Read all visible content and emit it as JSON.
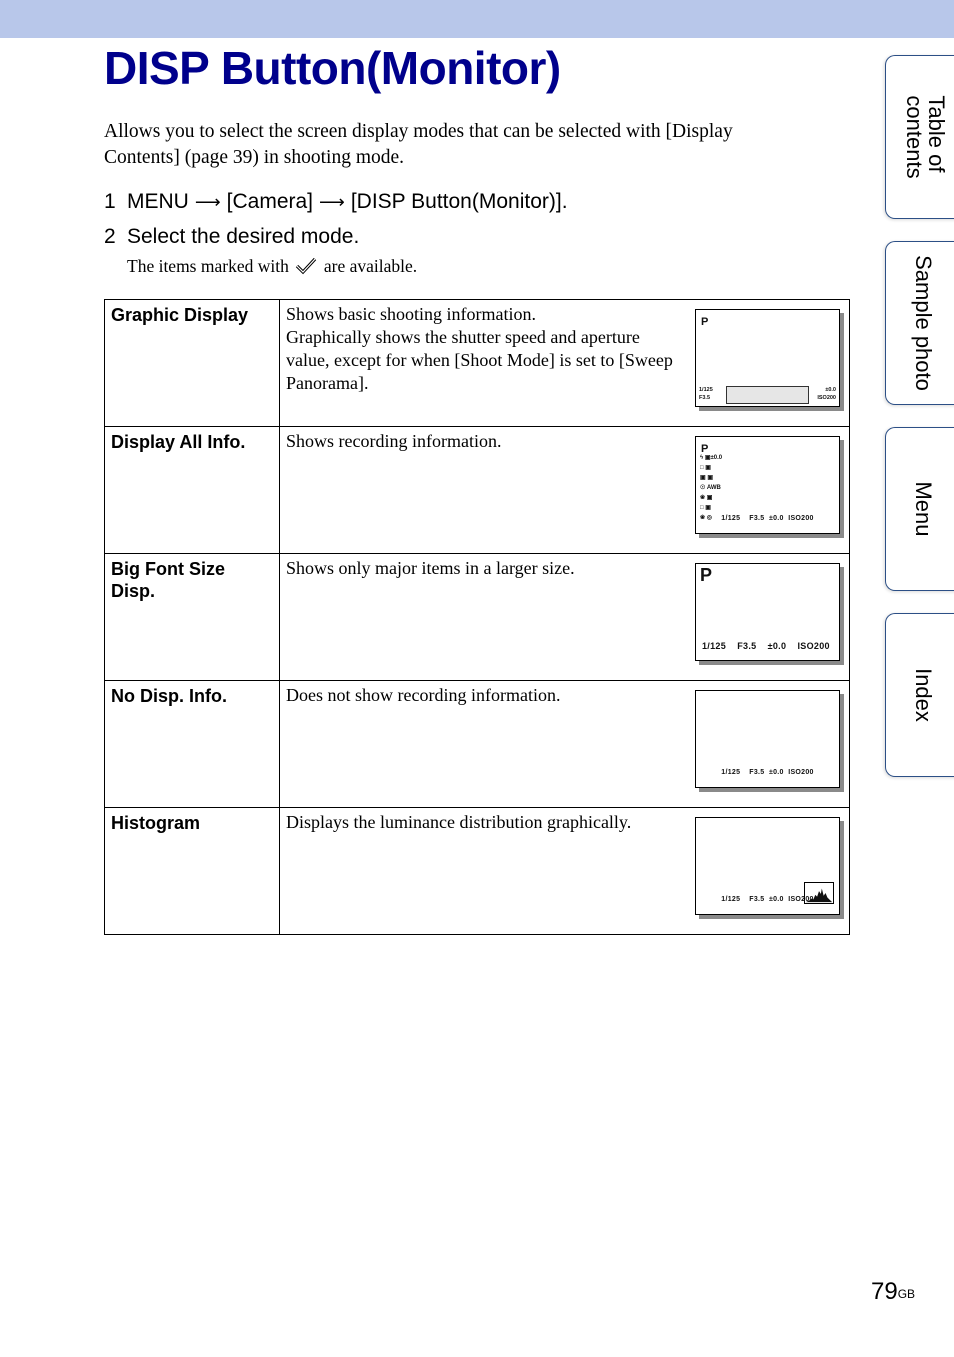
{
  "page": {
    "title": "DISP Button(Monitor)",
    "intro": "Allows you to select the screen display modes that can be selected with [Display Contents] (page 39) in shooting mode.",
    "steps": [
      {
        "number": "1",
        "parts": [
          "MENU",
          "[Camera]",
          "[DISP Button(Monitor)]."
        ],
        "arrow": "⟶"
      },
      {
        "number": "2",
        "text": "Select the desired mode."
      }
    ],
    "note_before": "The items marked with",
    "note_after": "are available.",
    "note_icon": "checkmark-icon",
    "page_number": "79",
    "page_suffix": "GB"
  },
  "modes": [
    {
      "name": "Graphic Display",
      "description": "Shows basic shooting information.\nGraphically shows the shutter speed and aperture value, except for when [Shoot Mode] is set to [Sweep Panorama].",
      "screen": {
        "mode": "P",
        "left_lines": [
          "1/125",
          "F3.5"
        ],
        "right_lines": [
          "±0.0",
          "ISO200"
        ]
      }
    },
    {
      "name": "Display All Info.",
      "description": "Shows recording information.",
      "screen": {
        "mode": "P",
        "bottom": "1/125    F3.5  ±0.0  ISO200",
        "side_icons": [
          "ϟ ▣±0.0",
          "□ ▣",
          "▣ ▣",
          "☉ AWB",
          "❀ ▣",
          "□ ▣",
          "❀ ◎"
        ]
      }
    },
    {
      "name": "Big Font Size Disp.",
      "description": "Shows only major items in a larger size.",
      "screen": {
        "mode": "P",
        "bottom": "1/125    F3.5    ±0.0    ISO200"
      }
    },
    {
      "name": "No Disp. Info.",
      "description": "Does not show recording information.",
      "screen": {
        "bottom": "1/125    F3.5  ±0.0  ISO200"
      }
    },
    {
      "name": "Histogram",
      "description": "Displays the luminance distribution graphically.",
      "screen": {
        "bottom": "1/125    F3.5  ±0.0  ISO200"
      }
    }
  ],
  "side_tabs": [
    {
      "label": "Table of\ncontents"
    },
    {
      "label": "Sample photo"
    },
    {
      "label": "Menu"
    },
    {
      "label": "Index"
    }
  ],
  "colors": {
    "title": "#00008c",
    "top_band": "#b8c7ea",
    "tab_border": "#2c4f86"
  }
}
